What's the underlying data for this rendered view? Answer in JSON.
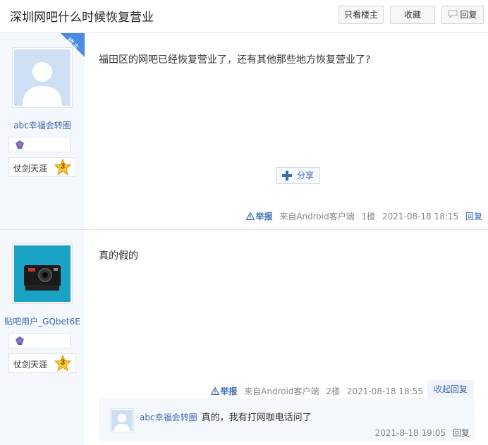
{
  "header": {
    "title": "深圳网吧什么时候恢复营业",
    "only_op_label": "只看楼主",
    "favorite_label": "收藏",
    "reply_label": "回复"
  },
  "posts": [
    {
      "username": "abc幸福会转圈",
      "is_op": true,
      "op_tag": "楼主",
      "level_name": "仗剑天涯",
      "level": "3",
      "content": "福田区的网吧已经恢复营业了，还有其他那些地方恢复营业了?",
      "share_label": "分享",
      "report_label": "举报",
      "source": "来自Android客户端",
      "floor": "1楼",
      "time": "2021-08-18 18:15",
      "reply_label": "回复"
    },
    {
      "username": "贴吧用户_GQbet6E",
      "level_name": "仗剑天涯",
      "level": "3",
      "content": "真的假的",
      "report_label": "举报",
      "source": "来自Android客户端",
      "floor": "2楼",
      "time": "2021-08-18 18:55",
      "collapse_label": "收起回复",
      "comments": [
        {
          "username": "abc幸福会转圈",
          "text": "真的，我有打网咖电话问了",
          "time": "2021-8-18 19:05",
          "reply_label": "回复"
        }
      ]
    }
  ],
  "colors": {
    "link": "#3c6bb1",
    "sidebar_bg": "#f4f7fb",
    "op_tag": "#4a8be0"
  }
}
